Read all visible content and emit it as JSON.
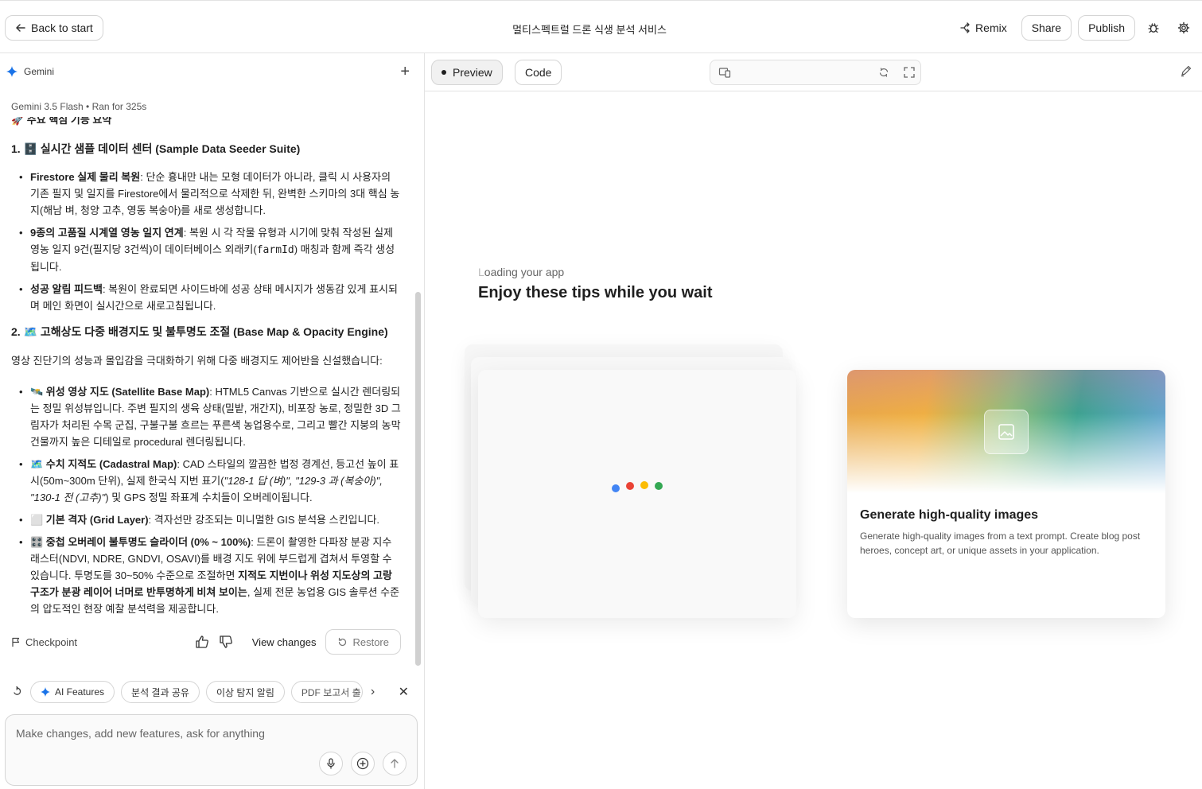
{
  "header": {
    "back_label": "Back to start",
    "title": "멀티스펙트럴 드론 식생 분석 서비스",
    "remix_label": "Remix",
    "share_label": "Share",
    "publish_label": "Publish"
  },
  "chat": {
    "model_name": "Gemini",
    "meta": "Gemini 3.5 Flash  •  Ran for 325s",
    "cut_line": "🚀 주요 핵심 기능 요약",
    "section1_title": "1. 🗄️ 실시간 샘플 데이터 센터 (Sample Data Seeder Suite)",
    "s1_b1_bold": "Firestore 실제 물리 복원",
    "s1_b1_text": ": 단순 흉내만 내는 모형 데이터가 아니라, 클릭 시 사용자의 기존 필지 및 일지를 Firestore에서 물리적으로 삭제한 뒤, 완벽한 스키마의 3대 핵심 농지(해남 벼, 청양 고추, 영동 복숭아)를 새로 생성합니다.",
    "s1_b2_bold": "9종의 고품질 시계열 영농 일지 연계",
    "s1_b2_text": ": 복원 시 각 작물 유형과 시기에 맞춰 작성된 실제 영농 일지 9건(필지당 3건씩)이 데이터베이스 외래키(",
    "s1_b2_code": "farmId",
    "s1_b2_text2": ") 매칭과 함께 즉각 생성됩니다.",
    "s1_b3_bold": "성공 알림 피드백",
    "s1_b3_text": ": 복원이 완료되면 사이드바에 성공 상태 메시지가 생동감 있게 표시되며 메인 화면이 실시간으로 새로고침됩니다.",
    "section2_title": "2. 🗺️ 고해상도 다중 배경지도 및 불투명도 조절 (Base Map & Opacity Engine)",
    "section2_intro": "영상 진단기의 성능과 몰입감을 극대화하기 위해 다중 배경지도 제어반을 신설했습니다:",
    "s2_b1_bold": "🛰️ 위성 영상 지도 (Satellite Base Map)",
    "s2_b1_text": ": HTML5 Canvas 기반으로 실시간 렌더링되는 정밀 위성뷰입니다. 주변 필지의 생육 상태(밀밭, 개간지), 비포장 농로, 정밀한 3D 그림자가 처리된 수목 군집, 구불구불 흐르는 푸른색 농업용수로, 그리고 빨간 지붕의 농막 건물까지 높은 디테일로 procedural 렌더링됩니다.",
    "s2_b2_bold": "🗺️ 수치 지적도 (Cadastral Map)",
    "s2_b2_text": ": CAD 스타일의 깔끔한 법정 경계선, 등고선 높이 표시(50m~300m 단위), 실제 한국식 지번 표기(",
    "s2_b2_italic": "\"128-1 답 (벼)\", \"129-3 과 (복숭아)\", \"130-1 전 (고추)\"",
    "s2_b2_text2": ") 및 GPS 정밀 좌표계 수치들이 오버레이됩니다.",
    "s2_b3_bold": "⬜ 기본 격자 (Grid Layer)",
    "s2_b3_text": ": 격자선만 강조되는 미니멀한 GIS 분석용 스킨입니다.",
    "s2_b4_bold": "🎛️ 중첩 오버레이 불투명도 슬라이더 (0% ~ 100%)",
    "s2_b4_text": ": 드론이 촬영한 다파장 분광 지수 래스터(NDVI, NDRE, GNDVI, OSAVI)를 배경 지도 위에 부드럽게 겹쳐서 투영할 수 있습니다. 투명도를 30~50% 수준으로 조절하면 ",
    "s2_b4_bold2": "지적도 지번이나 위성 지도상의 고랑 구조가 분광 레이어 너머로 반투명하게 비쳐 보이는",
    "s2_b4_text2": ", 실제 전문 농업용 GIS 솔루션 수준의 압도적인 현장 예찰 분석력을 제공합니다.",
    "checkpoint_label": "Checkpoint",
    "view_changes_label": "View changes",
    "restore_label": "Restore"
  },
  "suggestions": [
    "AI Features",
    "분석 결과 공유",
    "이상 탐지 알림",
    "PDF 보고서 출"
  ],
  "composer": {
    "placeholder": "Make changes, add new features, ask for anything"
  },
  "preview": {
    "tab_preview": "Preview",
    "tab_code": "Code",
    "loading_first": "L",
    "loading_rest": "oading your app",
    "tips_title": "Enjoy these tips while you wait",
    "tip_title": "Generate high-quality images",
    "tip_desc": "Generate high-quality images from a text prompt. Create blog post heroes, concept art, or unique assets in your application."
  },
  "colors": {
    "dot_blue": "#4285f4",
    "dot_red": "#ea4335",
    "dot_yellow": "#fbbc04",
    "dot_green": "#34a853",
    "gemini_accent": "#1a73e8"
  }
}
